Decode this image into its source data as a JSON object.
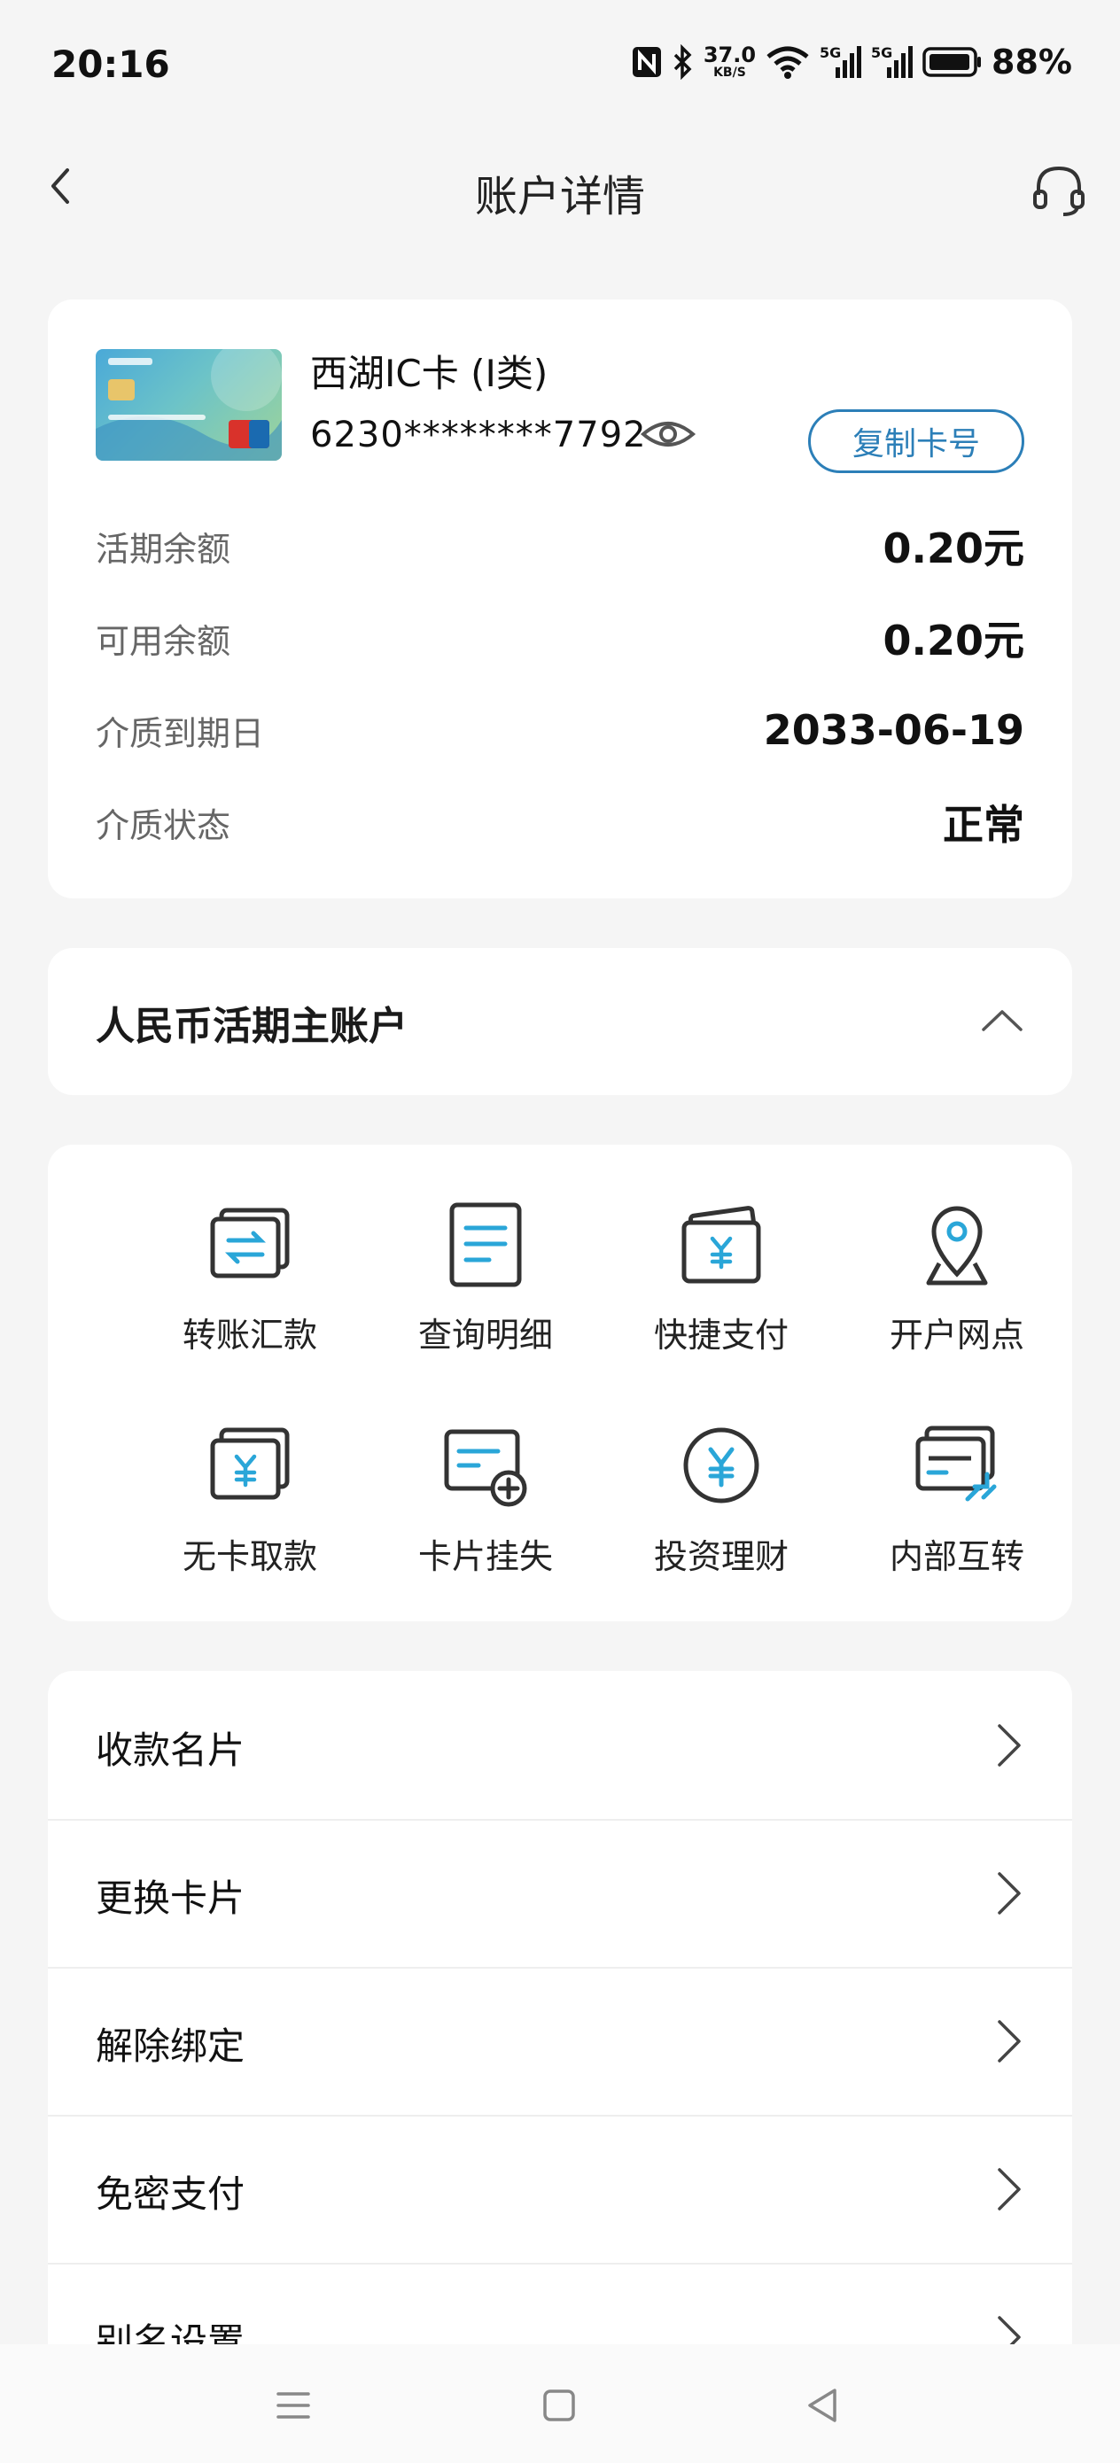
{
  "status_bar": {
    "time": "20:16",
    "net_speed_value": "37.0",
    "net_speed_unit": "KB/S",
    "signal1_label": "5G",
    "signal2_label": "5G",
    "battery": "88%"
  },
  "header": {
    "title": "账户详情"
  },
  "account_card": {
    "card_name": "西湖IC卡 (I类)",
    "card_number": "6230********7792",
    "copy_button": "复制卡号",
    "rows": [
      {
        "label": "活期余额",
        "value": "0.20元"
      },
      {
        "label": "可用余额",
        "value": "0.20元"
      },
      {
        "label": "介质到期日",
        "value": "2033-06-19"
      },
      {
        "label": "介质状态",
        "value": "正常"
      }
    ]
  },
  "main_account": {
    "title": "人民币活期主账户"
  },
  "actions": [
    {
      "label": "转账汇款",
      "icon": "transfer-icon"
    },
    {
      "label": "查询明细",
      "icon": "details-icon"
    },
    {
      "label": "快捷支付",
      "icon": "quick-pay-icon"
    },
    {
      "label": "开户网点",
      "icon": "location-pin-icon"
    },
    {
      "label": "无卡取款",
      "icon": "cardless-withdraw-icon"
    },
    {
      "label": "卡片挂失",
      "icon": "card-report-loss-icon"
    },
    {
      "label": "投资理财",
      "icon": "yuan-coin-icon"
    },
    {
      "label": "内部互转",
      "icon": "internal-transfer-icon"
    }
  ],
  "menu": [
    {
      "label": "收款名片"
    },
    {
      "label": "更换卡片"
    },
    {
      "label": "解除绑定"
    },
    {
      "label": "免密支付"
    },
    {
      "label": "别名设置"
    }
  ],
  "colors": {
    "accent": "#2c7fb8",
    "icon_blue": "#2aa6d8",
    "icon_dark": "#333333"
  }
}
